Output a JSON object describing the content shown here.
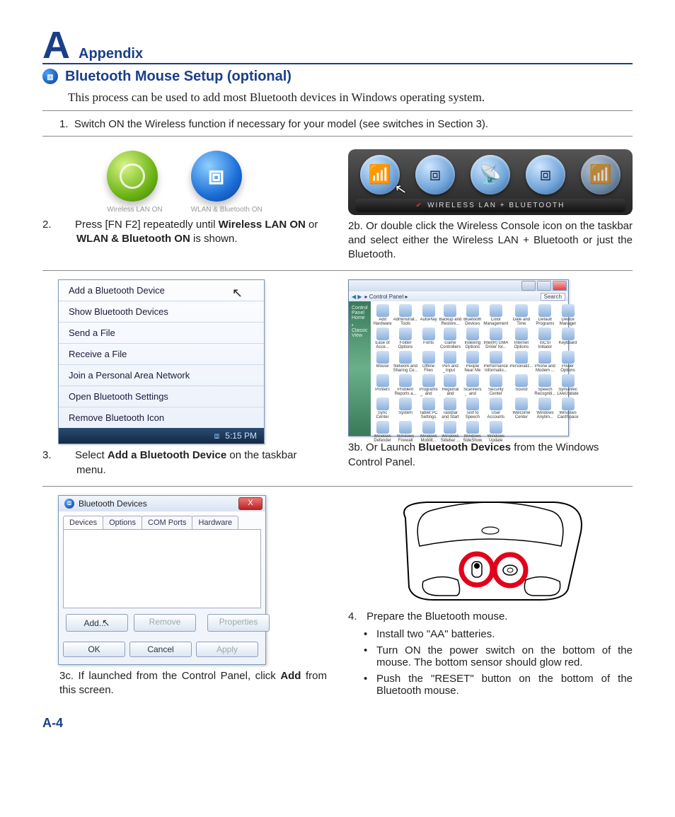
{
  "header": {
    "letter": "A",
    "word": "Appendix"
  },
  "section": {
    "title": "Bluetooth Mouse Setup (optional)",
    "intro": "This process can be used to add most Bluetooth devices in Windows operating system."
  },
  "step1": {
    "num": "1.",
    "text": "Switch ON the Wireless function if necessary for your model (see switches in Section 3)."
  },
  "orbs": {
    "wlan_label": "Wireless LAN ON",
    "both_label": "WLAN & Bluetooth ON"
  },
  "console": {
    "label_prefix": "✔",
    "label": "WIRELESS LAN + BLUETOOTH"
  },
  "step2": {
    "num": "2.",
    "pre": "Press [FN F2] repeatedly until ",
    "bold1": "Wireless LAN ON",
    "mid": " or ",
    "bold2": "WLAN & Bluetooth ON",
    "post": " is shown."
  },
  "step2b": {
    "num": "2b.",
    "text": "Or double click the Wireless Console icon on the taskbar and select either the Wireless LAN + Bluetooth or just the Bluetooth."
  },
  "menu": {
    "items": [
      "Add a Bluetooth Device",
      "Show Bluetooth Devices",
      "Send a File",
      "Receive a File",
      "Join a Personal Area Network",
      "Open Bluetooth Settings",
      "Remove Bluetooth Icon"
    ],
    "time": "5:15 PM"
  },
  "cp": {
    "addr": "▸ Control Panel ▸",
    "search": "Search",
    "side1": "Control Panel Home",
    "side2": "• Classic View",
    "items": [
      "Add Hardware",
      "Administrat... Tools",
      "AutoPlay",
      "Backup and Restore...",
      "Bluetooth Devices",
      "Color Management",
      "Date and Time",
      "Default Programs",
      "Device Manager",
      "Ease of Acce...",
      "Folder Options",
      "Fonts",
      "Game Controllers",
      "Indexing Options",
      "Intel(R) GMA Driver for...",
      "Internet Options",
      "iSCSI Initiator",
      "Keyboard",
      "Mouse",
      "Network and Sharing Ce...",
      "Offline Files",
      "Pen and Input Devices",
      "People Near Me",
      "Performance Informatio...",
      "Personaliz...",
      "Phone and Modem ...",
      "Power Options",
      "Printers",
      "Problem Reports a...",
      "Programs and Features",
      "Regional and Language...",
      "Scanners and Cameras",
      "Security Center",
      "Sound",
      "Speech Recogniti...",
      "Symantec LiveUpdate",
      "Sync Center",
      "System",
      "Tablet PC Settings",
      "Taskbar and Start Menu",
      "Text to Speech",
      "User Accounts",
      "Welcome Center",
      "Windows Anytim...",
      "Windows CardSpace",
      "Windows Defender",
      "Windows Firewall",
      "Windows Mobilit...",
      "Windows Sidebar ...",
      "Windows SideShow",
      "Windows Update"
    ]
  },
  "step3": {
    "num": "3.",
    "pre": "Select ",
    "bold": "Add a Bluetooth Device",
    "post": " on the taskbar menu."
  },
  "step3b": {
    "num": "3b.",
    "pre": "Or Launch ",
    "bold": "Bluetooth Devices",
    "post": " from the Windows Control Panel."
  },
  "btDialog": {
    "title": "Bluetooth Devices",
    "tabs": [
      "Devices",
      "Options",
      "COM Ports",
      "Hardware"
    ],
    "add": "Add...",
    "remove": "Remove",
    "properties": "Properties",
    "ok": "OK",
    "cancel": "Cancel",
    "apply": "Apply"
  },
  "step3c": {
    "num": "3c.",
    "pre": "If launched from the Control Panel, click ",
    "bold": "Add",
    "post": " from this screen."
  },
  "step4": {
    "num": "4.",
    "text": "Prepare the Bluetooth mouse.",
    "bullets": [
      "Install two \"AA\" batteries.",
      "Turn ON the power switch on the bottom of the mouse. The bottom sensor should glow red.",
      "Push the \"RESET\" button on the bottom of the Bluetooth mouse."
    ]
  },
  "pagenum": "A-4"
}
